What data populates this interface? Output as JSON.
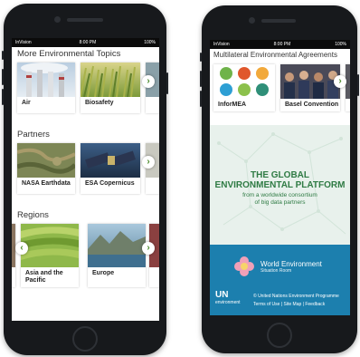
{
  "left_phone": {
    "status": {
      "carrier": "InVision",
      "time": "8:00 PM",
      "battery": "100%"
    },
    "sections": [
      {
        "title": "More Environmental Topics",
        "cards": [
          {
            "label": "Air"
          },
          {
            "label": "Biosafety"
          }
        ]
      },
      {
        "title": "Partners",
        "cards": [
          {
            "label": "NASA Earthdata"
          },
          {
            "label": "ESA Copernicus"
          }
        ]
      },
      {
        "title": "Regions",
        "cards": [
          {
            "label": "Asia and the Pacific"
          },
          {
            "label": "Europe"
          }
        ]
      }
    ]
  },
  "right_phone": {
    "status": {
      "carrier": "InVision",
      "time": "8:00 PM",
      "battery": "100%"
    },
    "section_title": "Multilateral Environmental Agreements",
    "cards": [
      {
        "label": "InforMEA"
      },
      {
        "label": "Basel Convention"
      }
    ],
    "platform": {
      "title_line1": "THE GLOBAL",
      "title_line2": "ENVIRONMENTAL PLATFORM",
      "subtitle_line1": "from a worldwide consortium",
      "subtitle_line2": "of big data partners"
    },
    "wesr": {
      "title": "World Environment",
      "subtitle": "Situation Room"
    },
    "footer": {
      "un_logo": "UN",
      "un_sub": "environment",
      "org": "© United Nations Environment Programme",
      "links": "Terms of Use  |  Site Map  |  Feedback"
    }
  },
  "colors": {
    "accent_green": "#4a8a2a",
    "platform_green": "#2f7b44",
    "footer_blue": "#1c7fae"
  }
}
